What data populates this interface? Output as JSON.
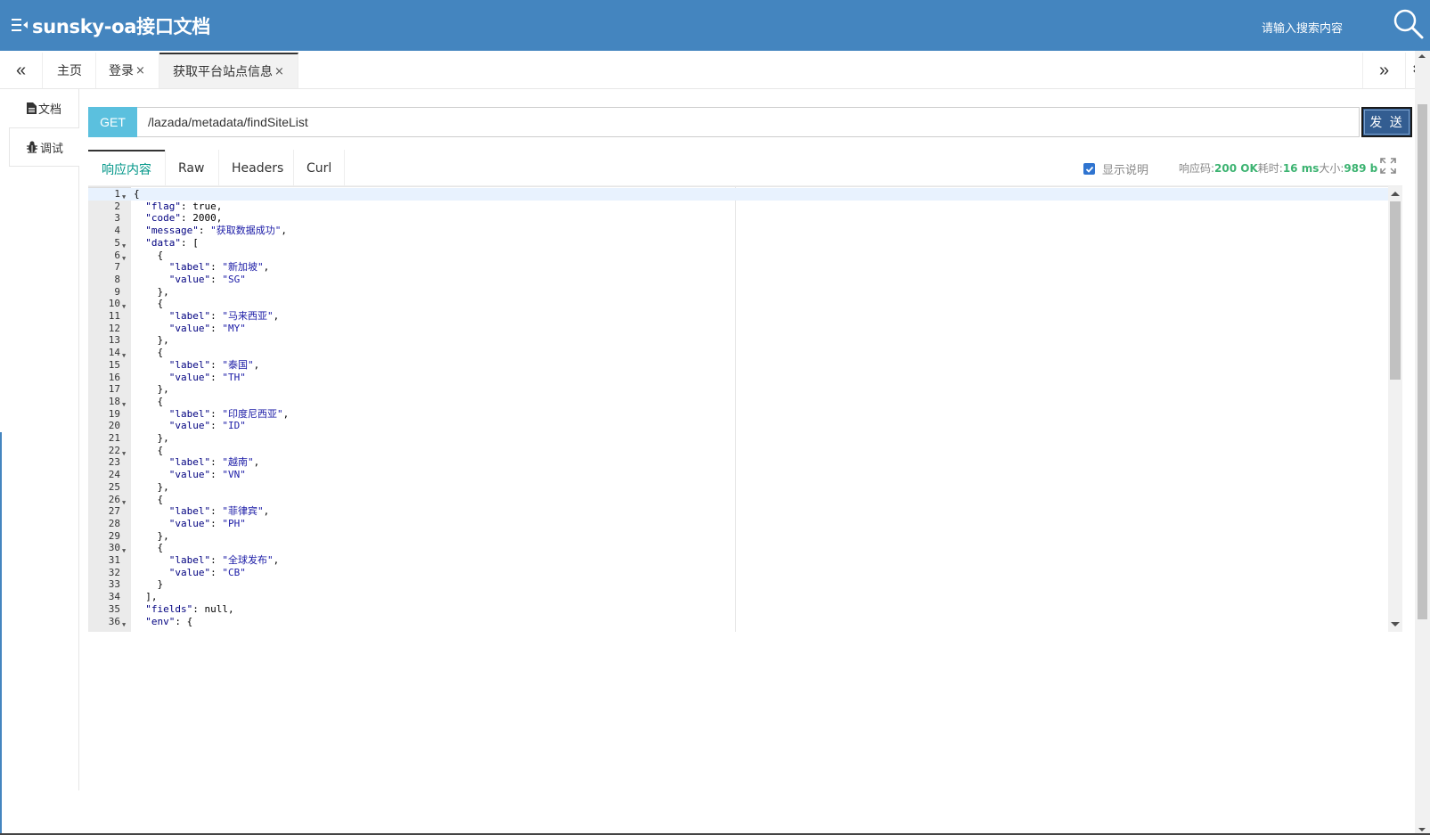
{
  "header": {
    "title": "sunsky-oa接口文档",
    "search_placeholder": "请输入搜索内容"
  },
  "tabs": {
    "prev_icon": "«",
    "next_icon": "»",
    "more_icon": "chevron-double-down",
    "items": [
      {
        "label": "主页",
        "closable": false,
        "active": false
      },
      {
        "label": "登录",
        "closable": true,
        "active": false
      },
      {
        "label": "获取平台站点信息",
        "closable": true,
        "active": true
      }
    ],
    "close_symbol": "×"
  },
  "sidebar": {
    "items": [
      {
        "label": "文档",
        "icon": "file-icon",
        "active": false
      },
      {
        "label": "调试",
        "icon": "bug-icon",
        "active": true
      }
    ]
  },
  "request": {
    "method": "GET",
    "url": "/lazada/metadata/findSiteList",
    "send_label": "发 送"
  },
  "response": {
    "tabs": [
      "响应内容",
      "Raw",
      "Headers",
      "Curl"
    ],
    "active_tab": "响应内容",
    "show_desc_label": "显示说明",
    "show_desc_checked": true,
    "status_label": "响应码:",
    "status_value": "200 OK",
    "time_label": "耗时:",
    "time_value": "16 ms",
    "size_label": "大小:",
    "size_value": "989 b"
  },
  "colors": {
    "header_bg": "#4485bf",
    "method_bg": "#5bc0de",
    "send_bg": "#335d91",
    "active_tab_text": "#009688",
    "status_ok": "#3cb371"
  },
  "editor": {
    "lines": [
      {
        "n": "1",
        "fold": true,
        "text": "{"
      },
      {
        "n": "2",
        "text": "  \"flag\": true,"
      },
      {
        "n": "3",
        "text": "  \"code\": 2000,"
      },
      {
        "n": "4",
        "text": "  \"message\": \"获取数据成功\","
      },
      {
        "n": "5",
        "fold": true,
        "text": "  \"data\": ["
      },
      {
        "n": "6",
        "fold": true,
        "text": "    {"
      },
      {
        "n": "7",
        "text": "      \"label\": \"新加坡\","
      },
      {
        "n": "8",
        "text": "      \"value\": \"SG\""
      },
      {
        "n": "9",
        "text": "    },"
      },
      {
        "n": "10",
        "fold": true,
        "text": "    {"
      },
      {
        "n": "11",
        "text": "      \"label\": \"马来西亚\","
      },
      {
        "n": "12",
        "text": "      \"value\": \"MY\""
      },
      {
        "n": "13",
        "text": "    },"
      },
      {
        "n": "14",
        "fold": true,
        "text": "    {"
      },
      {
        "n": "15",
        "text": "      \"label\": \"泰国\","
      },
      {
        "n": "16",
        "text": "      \"value\": \"TH\""
      },
      {
        "n": "17",
        "text": "    },"
      },
      {
        "n": "18",
        "fold": true,
        "text": "    {"
      },
      {
        "n": "19",
        "text": "      \"label\": \"印度尼西亚\","
      },
      {
        "n": "20",
        "text": "      \"value\": \"ID\""
      },
      {
        "n": "21",
        "text": "    },"
      },
      {
        "n": "22",
        "fold": true,
        "text": "    {"
      },
      {
        "n": "23",
        "text": "      \"label\": \"越南\","
      },
      {
        "n": "24",
        "text": "      \"value\": \"VN\""
      },
      {
        "n": "25",
        "text": "    },"
      },
      {
        "n": "26",
        "fold": true,
        "text": "    {"
      },
      {
        "n": "27",
        "text": "      \"label\": \"菲律宾\","
      },
      {
        "n": "28",
        "text": "      \"value\": \"PH\""
      },
      {
        "n": "29",
        "text": "    },"
      },
      {
        "n": "30",
        "fold": true,
        "text": "    {"
      },
      {
        "n": "31",
        "text": "      \"label\": \"全球发布\","
      },
      {
        "n": "32",
        "text": "      \"value\": \"CB\""
      },
      {
        "n": "33",
        "text": "    }"
      },
      {
        "n": "34",
        "text": "  ],"
      },
      {
        "n": "35",
        "text": "  \"fields\": null,"
      },
      {
        "n": "36",
        "fold": true,
        "text": "  \"env\": {"
      }
    ]
  }
}
